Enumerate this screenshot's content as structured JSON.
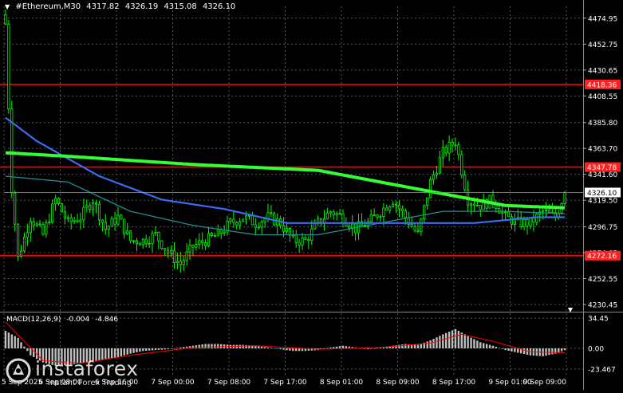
{
  "header": {
    "symbol": "#Ethereum,M30",
    "open": "4317.82",
    "high": "4326.19",
    "low": "4315.08",
    "close": "4326.10"
  },
  "macd": {
    "label": "MACD(12,26,9)",
    "main_value": "-0.004",
    "signal_value": "-4.846",
    "ticks": [
      "34.45",
      "0.00",
      "-23.467"
    ]
  },
  "logo": {
    "name": "instaforex",
    "tagline": "Instant Forex Trading"
  },
  "colors": {
    "background": "#000000",
    "candle": "#00ff00",
    "level_line": "#ff0000",
    "ma_slow": "#33ff33",
    "ma_blue": "#3a6df0",
    "ma_teal": "#1f8f8f",
    "macd_hist": "#c0c0c0",
    "macd_signal": "#ff0000",
    "price_tag": "#ff2020",
    "current_tag": "#ffffff"
  },
  "chart_data": {
    "type": "candlestick",
    "symbol": "#Ethereum",
    "timeframe": "M30",
    "y_ticks": [
      "4474.95",
      "4452.75",
      "4430.65",
      "4408.55",
      "4385.80",
      "4363.70",
      "4341.60",
      "4319.50",
      "4296.75",
      "4274.65",
      "4252.55",
      "4230.45"
    ],
    "ylim": [
      4225,
      4485
    ],
    "x_ticks": [
      "5 Sep 2025",
      "6 Sep 08:00",
      "6 Sep 16:00",
      "7 Sep 00:00",
      "7 Sep 08:00",
      "7 Sep 17:00",
      "8 Sep 01:00",
      "8 Sep 09:00",
      "8 Sep 17:00",
      "9 Sep 01:00",
      "9 Sep 09:00"
    ],
    "levels": [
      {
        "label": "4418.36",
        "value": 4418.36
      },
      {
        "label": "4347.78",
        "value": 4347.78
      },
      {
        "label": "4272.16",
        "value": 4272.16
      }
    ],
    "current_price": {
      "label": "4326.10",
      "value": 4326.1
    },
    "close_path": [
      [
        0,
        4470
      ],
      [
        2,
        4330
      ],
      [
        4,
        4270
      ],
      [
        8,
        4305
      ],
      [
        12,
        4290
      ],
      [
        16,
        4320
      ],
      [
        20,
        4300
      ],
      [
        24,
        4305
      ],
      [
        28,
        4320
      ],
      [
        32,
        4295
      ],
      [
        36,
        4305
      ],
      [
        40,
        4285
      ],
      [
        44,
        4285
      ],
      [
        48,
        4290
      ],
      [
        52,
        4275
      ],
      [
        56,
        4265
      ],
      [
        60,
        4280
      ],
      [
        64,
        4285
      ],
      [
        68,
        4290
      ],
      [
        72,
        4300
      ],
      [
        76,
        4305
      ],
      [
        80,
        4300
      ],
      [
        84,
        4305
      ],
      [
        88,
        4300
      ],
      [
        92,
        4285
      ],
      [
        96,
        4285
      ],
      [
        100,
        4300
      ],
      [
        104,
        4310
      ],
      [
        108,
        4305
      ],
      [
        112,
        4295
      ],
      [
        116,
        4300
      ],
      [
        120,
        4310
      ],
      [
        124,
        4320
      ],
      [
        128,
        4305
      ],
      [
        132,
        4290
      ],
      [
        136,
        4335
      ],
      [
        140,
        4360
      ],
      [
        144,
        4370
      ],
      [
        148,
        4320
      ],
      [
        152,
        4315
      ],
      [
        156,
        4320
      ],
      [
        160,
        4305
      ],
      [
        164,
        4300
      ],
      [
        168,
        4300
      ],
      [
        172,
        4310
      ],
      [
        176,
        4305
      ],
      [
        179,
        4326.1
      ]
    ],
    "ma_slow": [
      [
        0,
        4360
      ],
      [
        20,
        4357
      ],
      [
        60,
        4350
      ],
      [
        100,
        4345
      ],
      [
        130,
        4330
      ],
      [
        160,
        4315
      ],
      [
        179,
        4313
      ]
    ],
    "ma_blue": [
      [
        0,
        4390
      ],
      [
        10,
        4370
      ],
      [
        30,
        4340
      ],
      [
        50,
        4320
      ],
      [
        70,
        4312
      ],
      [
        90,
        4300
      ],
      [
        110,
        4300
      ],
      [
        130,
        4300
      ],
      [
        150,
        4300
      ],
      [
        170,
        4305
      ],
      [
        179,
        4305
      ]
    ],
    "ma_teal": [
      [
        0,
        4340
      ],
      [
        20,
        4335
      ],
      [
        40,
        4310
      ],
      [
        60,
        4298
      ],
      [
        80,
        4290
      ],
      [
        100,
        4290
      ],
      [
        120,
        4300
      ],
      [
        140,
        4310
      ],
      [
        160,
        4310
      ],
      [
        179,
        4308
      ]
    ],
    "macd_histogram": [
      [
        0,
        20
      ],
      [
        4,
        12
      ],
      [
        8,
        -8
      ],
      [
        12,
        -16
      ],
      [
        16,
        -20
      ],
      [
        20,
        -19
      ],
      [
        24,
        -17
      ],
      [
        28,
        -16
      ],
      [
        32,
        -12
      ],
      [
        36,
        -10
      ],
      [
        40,
        -6
      ],
      [
        44,
        -3
      ],
      [
        48,
        -2
      ],
      [
        52,
        -1
      ],
      [
        56,
        1
      ],
      [
        60,
        3
      ],
      [
        64,
        5
      ],
      [
        68,
        5
      ],
      [
        72,
        4
      ],
      [
        76,
        4
      ],
      [
        80,
        3
      ],
      [
        84,
        1
      ],
      [
        88,
        -1
      ],
      [
        92,
        -3
      ],
      [
        96,
        -3
      ],
      [
        100,
        -2
      ],
      [
        104,
        1
      ],
      [
        108,
        3
      ],
      [
        112,
        1
      ],
      [
        116,
        -1
      ],
      [
        120,
        1
      ],
      [
        124,
        3
      ],
      [
        128,
        5
      ],
      [
        132,
        4
      ],
      [
        136,
        9
      ],
      [
        140,
        16
      ],
      [
        144,
        22
      ],
      [
        148,
        14
      ],
      [
        152,
        7
      ],
      [
        156,
        3
      ],
      [
        160,
        -2
      ],
      [
        164,
        -5
      ],
      [
        168,
        -8
      ],
      [
        172,
        -9
      ],
      [
        176,
        -6
      ],
      [
        179,
        -2
      ]
    ],
    "macd_signal": [
      [
        0,
        30
      ],
      [
        6,
        8
      ],
      [
        12,
        -14
      ],
      [
        24,
        -17
      ],
      [
        40,
        -8
      ],
      [
        60,
        1
      ],
      [
        80,
        3
      ],
      [
        100,
        -1
      ],
      [
        120,
        1
      ],
      [
        136,
        6
      ],
      [
        146,
        16
      ],
      [
        156,
        8
      ],
      [
        168,
        -4
      ],
      [
        179,
        -5
      ]
    ],
    "macd_ylim": [
      -30,
      40
    ],
    "grid": true
  }
}
